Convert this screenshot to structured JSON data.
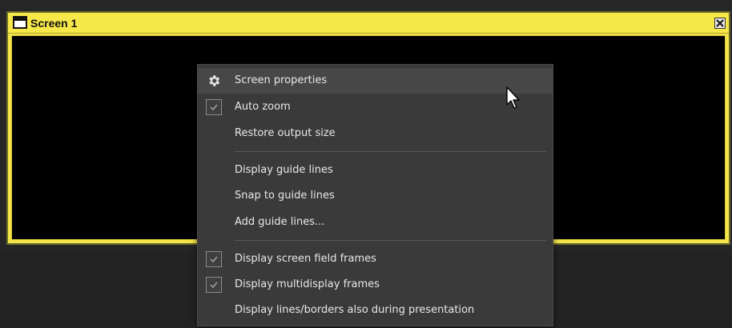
{
  "window": {
    "title": "Screen 1",
    "accent_color": "#f7e84a",
    "close_icon": "close-icon"
  },
  "context_menu": {
    "items": [
      {
        "label": "Screen properties",
        "icon": "gear-icon",
        "checked": null
      },
      {
        "label": "Auto zoom",
        "icon": "checkbox-icon",
        "checked": true
      },
      {
        "label": "Restore output size",
        "icon": null,
        "checked": null
      },
      {
        "label": "Display guide lines",
        "icon": null,
        "checked": null
      },
      {
        "label": "Snap to guide lines",
        "icon": null,
        "checked": null
      },
      {
        "label": "Add guide lines...",
        "icon": null,
        "checked": null
      },
      {
        "label": "Display screen field frames",
        "icon": "checkbox-icon",
        "checked": true
      },
      {
        "label": "Display multidisplay frames",
        "icon": "checkbox-icon",
        "checked": true
      },
      {
        "label": "Display lines/borders also during presentation",
        "icon": null,
        "checked": null
      }
    ]
  },
  "colors": {
    "menu_background": "#3a3a3a",
    "menu_text": "#e8e8e8",
    "canvas": "#000000"
  }
}
